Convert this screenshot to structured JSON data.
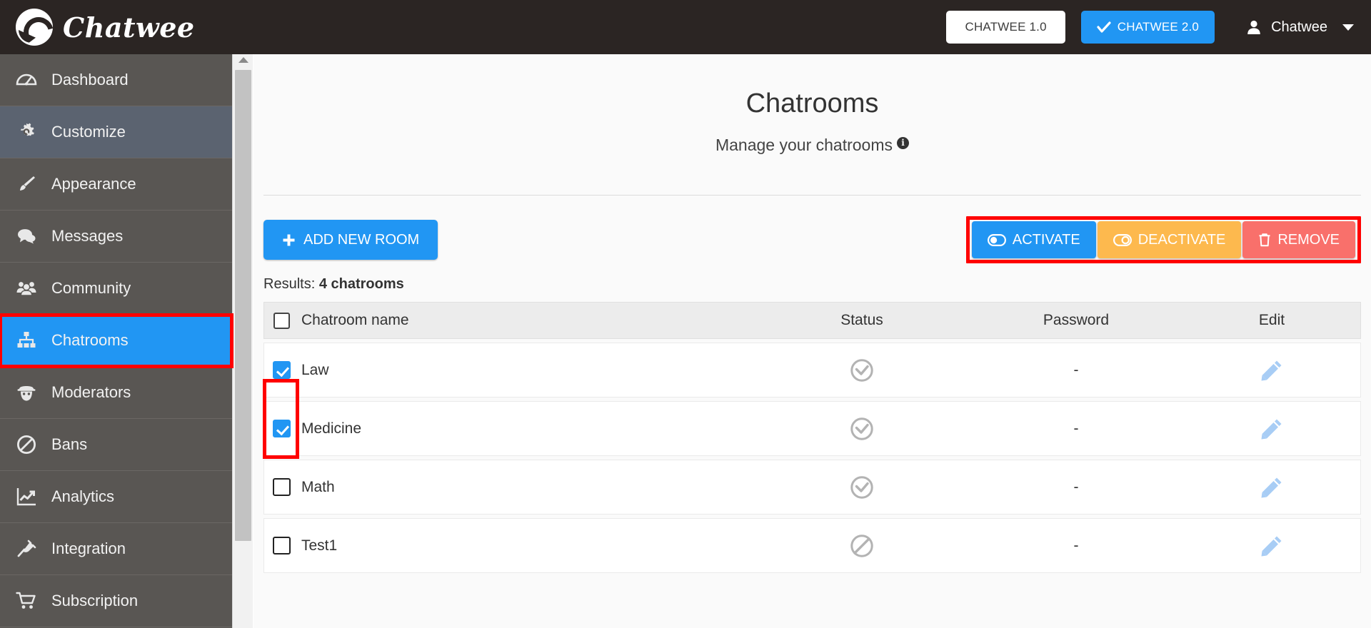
{
  "topbar": {
    "brand_name": "Chatwee",
    "brand_icon": "chatwee-logo-icon",
    "btn_v1_label": "CHATWEE 1.0",
    "btn_v2_label": "CHATWEE 2.0",
    "btn_v2_icon": "check-icon",
    "user_name": "Chatwee",
    "user_icon": "user-icon",
    "caret_icon": "chevron-down-icon"
  },
  "sidebar": {
    "items": [
      {
        "label": "Dashboard",
        "icon": "dashboard-gauge-icon",
        "state": "normal"
      },
      {
        "label": "Customize",
        "icon": "gear-icon",
        "state": "hover"
      },
      {
        "label": "Appearance",
        "icon": "paintbrush-icon",
        "state": "normal"
      },
      {
        "label": "Messages",
        "icon": "chat-bubbles-icon",
        "state": "normal"
      },
      {
        "label": "Community",
        "icon": "users-group-icon",
        "state": "normal"
      },
      {
        "label": "Chatrooms",
        "icon": "sitemap-icon",
        "state": "active"
      },
      {
        "label": "Moderators",
        "icon": "secret-agent-icon",
        "state": "normal"
      },
      {
        "label": "Bans",
        "icon": "ban-circle-icon",
        "state": "normal"
      },
      {
        "label": "Analytics",
        "icon": "line-chart-icon",
        "state": "normal"
      },
      {
        "label": "Integration",
        "icon": "plug-icon",
        "state": "normal"
      },
      {
        "label": "Subscription",
        "icon": "shopping-cart-icon",
        "state": "normal"
      }
    ]
  },
  "scrollbar": {
    "up_arrow_icon": "scroll-up-arrow-icon",
    "thumb": "scroll-thumb"
  },
  "main": {
    "title": "Chatrooms",
    "subtitle": "Manage your chatrooms",
    "info_icon": "info-icon",
    "info_glyph": "i",
    "add_room_label": "ADD NEW ROOM",
    "add_room_icon": "plus-icon",
    "bulk_actions": [
      {
        "label": "ACTIVATE",
        "icon": "toggle-on-icon",
        "color": "#2196f3"
      },
      {
        "label": "DEACTIVATE",
        "icon": "toggle-off-icon",
        "color": "#fdb94e"
      },
      {
        "label": "REMOVE",
        "icon": "trash-icon",
        "color": "#f9706b"
      }
    ],
    "results_prefix": "Results: ",
    "results_count": "4 chatrooms",
    "table": {
      "columns": [
        "Chatroom name",
        "Status",
        "Password",
        "Edit"
      ],
      "select_all_checked": false,
      "rows": [
        {
          "name": "Law",
          "checked": true,
          "status_icon": "check-circle-icon",
          "password": "-",
          "edit_icon": "pencil-icon"
        },
        {
          "name": "Medicine",
          "checked": true,
          "status_icon": "check-circle-icon",
          "password": "-",
          "edit_icon": "pencil-icon"
        },
        {
          "name": "Math",
          "checked": false,
          "status_icon": "check-circle-icon",
          "password": "-",
          "edit_icon": "pencil-icon"
        },
        {
          "name": "Test1",
          "checked": false,
          "status_icon": "ban-circle-icon",
          "password": "-",
          "edit_icon": "pencil-icon"
        }
      ]
    }
  },
  "colors": {
    "accent_blue": "#2196f3",
    "topbar_dark": "#2b2523",
    "sidebar_gray": "#595653",
    "highlight_red": "#ff0000",
    "warning_orange": "#fdb94e",
    "danger_red": "#f9706b"
  }
}
